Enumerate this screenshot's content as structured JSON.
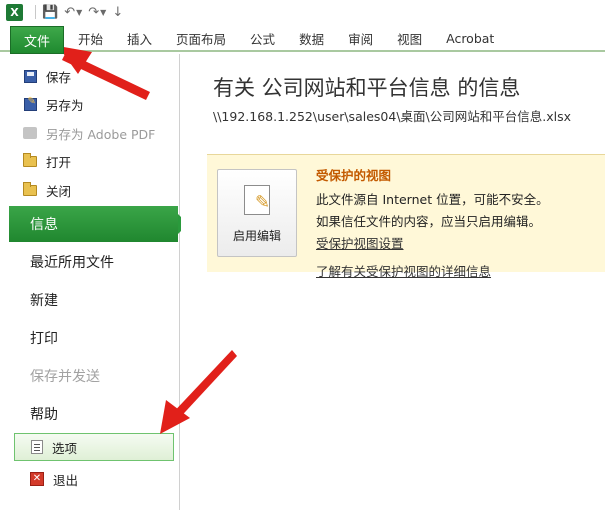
{
  "app": {
    "logo_letter": "X"
  },
  "ribbon": {
    "file_tab": "文件",
    "tabs": [
      "开始",
      "插入",
      "页面布局",
      "公式",
      "数据",
      "审阅",
      "视图",
      "Acrobat"
    ]
  },
  "nav": {
    "save": "保存",
    "save_as": "另存为",
    "save_as_pdf": "另存为 Adobe PDF",
    "open": "打开",
    "close": "关闭",
    "info": "信息",
    "recent": "最近所用文件",
    "new": "新建",
    "print": "打印",
    "save_send": "保存并发送",
    "help": "帮助",
    "options": "选项",
    "exit": "退出"
  },
  "main": {
    "title": "有关 公司网站和平台信息 的信息",
    "path": "\\\\192.168.1.252\\user\\sales04\\桌面\\公司网站和平台信息.xlsx",
    "protected_view": {
      "button_label": "启用编辑",
      "title": "受保护的视图",
      "line1": "此文件源自 Internet 位置，可能不安全。",
      "line2": "如果信任文件的内容，应当只启用编辑。",
      "link1": "受保护视图设置",
      "link2": "了解有关受保护视图的详细信息"
    }
  },
  "colors": {
    "accent_green": "#20872f",
    "arrow_red": "#e1201a",
    "warning_title": "#c35a00"
  }
}
